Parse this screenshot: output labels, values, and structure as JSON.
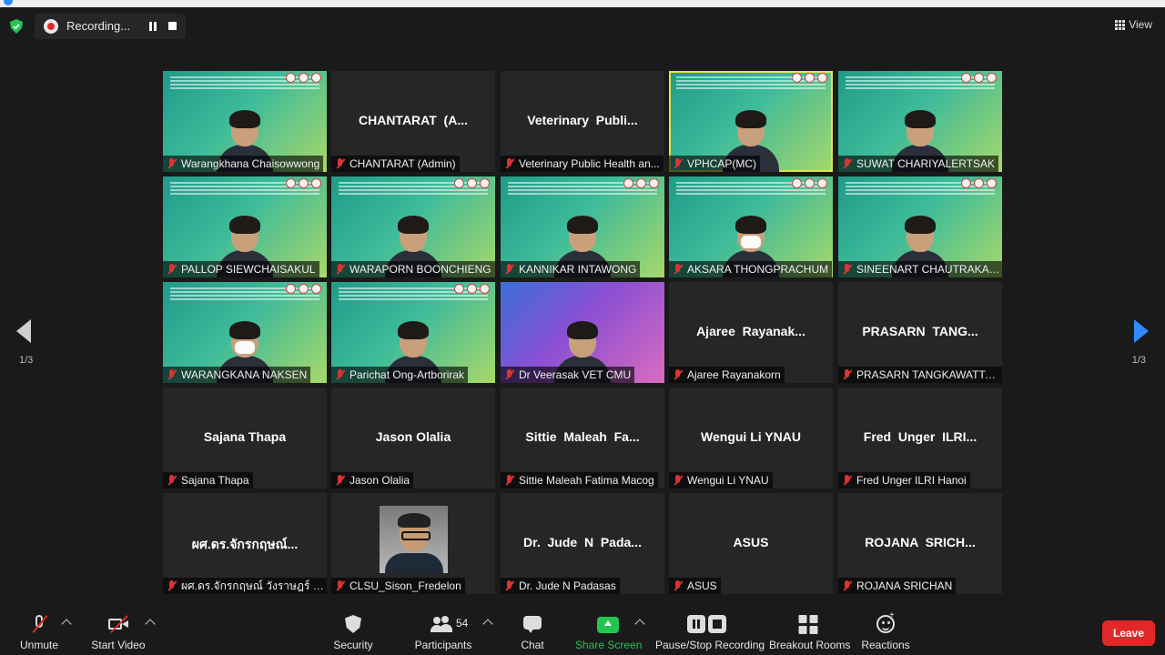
{
  "topbar": {
    "recording_label": "Recording...",
    "view_label": "View"
  },
  "pagination": {
    "left": "1/3",
    "right": "1/3"
  },
  "tiles": [
    {
      "name": "Warangkhana Chaisowwong",
      "center": "",
      "type": "video"
    },
    {
      "name": "CHANTARAT (Admin)",
      "center": "CHANTARAT  (A...",
      "type": "blank"
    },
    {
      "name": "Veterinary Public Health an...",
      "center": "Veterinary  Publi...",
      "type": "blank"
    },
    {
      "name": "VPHCAP(MC)",
      "center": "",
      "type": "video-active"
    },
    {
      "name": "SUWAT CHARIYALERTSAK",
      "center": "",
      "type": "video"
    },
    {
      "name": "PALLOP SIEWCHAISAKUL",
      "center": "",
      "type": "video"
    },
    {
      "name": "WARAPORN BOONCHIENG",
      "center": "",
      "type": "video"
    },
    {
      "name": "KANNIKAR INTAWONG",
      "center": "",
      "type": "video"
    },
    {
      "name": "AKSARA THONGPRACHUM",
      "center": "",
      "type": "video-mask"
    },
    {
      "name": "SINEENART CHAUTRAKARN",
      "center": "",
      "type": "video"
    },
    {
      "name": "WARANGKANA NAKSEN",
      "center": "",
      "type": "video-mask"
    },
    {
      "name": "Parichat Ong-Artborirak",
      "center": "",
      "type": "video"
    },
    {
      "name": "Dr Veerasak VET CMU",
      "center": "",
      "type": "purple"
    },
    {
      "name": "Ajaree Rayanakorn",
      "center": "Ajaree  Rayanak...",
      "type": "blank"
    },
    {
      "name": "PRASARN TANGKAWATTANA",
      "center": "PRASARN  TANG...",
      "type": "blank"
    },
    {
      "name": "Sajana Thapa",
      "center": "Sajana Thapa",
      "type": "blank"
    },
    {
      "name": "Jason Olalia",
      "center": "Jason Olalia",
      "type": "blank"
    },
    {
      "name": "Sittie Maleah Fatima Macog",
      "center": "Sittie  Maleah  Fa...",
      "type": "blank"
    },
    {
      "name": "Wengui Li YNAU",
      "center": "Wengui Li YNAU",
      "type": "blank"
    },
    {
      "name": "Fred Unger ILRI Hanoi",
      "center": "Fred  Unger  ILRI...",
      "type": "blank"
    },
    {
      "name": "ผศ.ดร.จักรกฤษณ์ วังราษฎร์ สา...",
      "center": "ผศ.ดร.จักรกฤษณ์...",
      "type": "blank"
    },
    {
      "name": "CLSU_Sison_Fredelon",
      "center": "",
      "type": "photo"
    },
    {
      "name": "Dr. Jude N Padasas",
      "center": "Dr.  Jude  N  Pada...",
      "type": "blank"
    },
    {
      "name": "ASUS",
      "center": "ASUS",
      "type": "blank"
    },
    {
      "name": "ROJANA SRICHAN",
      "center": "ROJANA  SRICH...",
      "type": "blank"
    }
  ],
  "toolbar": {
    "unmute": "Unmute",
    "start_video": "Start Video",
    "security": "Security",
    "participants": "Participants",
    "participants_count": "54",
    "chat": "Chat",
    "share_screen": "Share Screen",
    "pause_stop_recording": "Pause/Stop Recording",
    "breakout_rooms": "Breakout Rooms",
    "reactions": "Reactions",
    "leave": "Leave"
  },
  "colors": {
    "leave": "#e02828",
    "share": "#23c552",
    "active_speaker": "#e4e24a",
    "next_arrow": "#2d8cff"
  }
}
